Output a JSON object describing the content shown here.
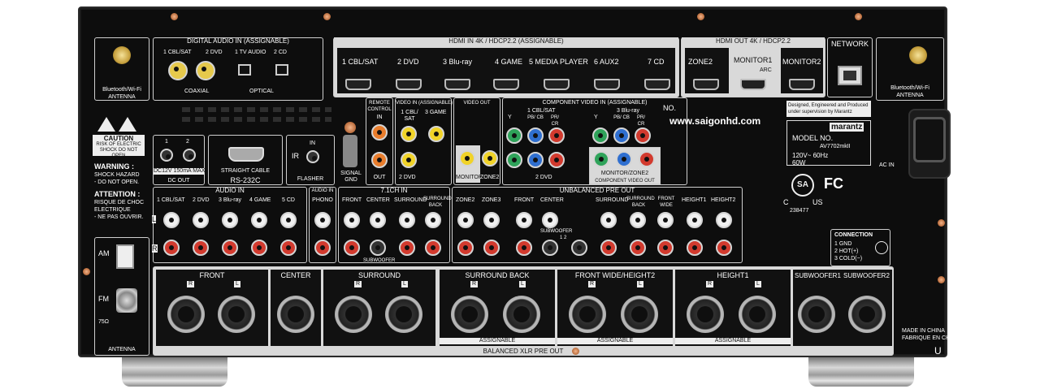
{
  "labels": {
    "bt_antenna_left": "Bluetooth/Wi-Fi",
    "bt_antenna_left_2": "ANTENNA",
    "digital_audio_in": "DIGITAL AUDIO IN",
    "assignable": "(ASSIGNABLE)",
    "digital_ports": [
      "1 CBL/SAT",
      "2 DVD",
      "1 TV AUDIO",
      "2 CD"
    ],
    "coaxial": "COAXIAL",
    "optical": "OPTICAL",
    "hdmi_in": "HDMI IN",
    "hdmi_spec": "4K / HDCP2.2",
    "hdmi_in_ports": [
      "1 CBL/SAT",
      "2 DVD",
      "3 Blu-ray",
      "4 GAME",
      "5 MEDIA PLAYER",
      "6 AUX2",
      "7 CD"
    ],
    "hdmi_out": "HDMI OUT",
    "hdmi_out_ports": [
      "ZONE2",
      "MONITOR1",
      "MONITOR2"
    ],
    "arc": "ARC",
    "network": "NETWORK",
    "bt_antenna_right": "Bluetooth/Wi-Fi",
    "bt_antenna_right_2": "ANTENNA",
    "remote_control": "REMOTE CONTROL",
    "remote_in": "IN",
    "remote_out": "OUT",
    "video_in": "VIDEO IN",
    "video_in_assignable": "(ASSIGNABLE)",
    "video_out": "VIDEO OUT",
    "video_ports": [
      "1 CBL/ SAT",
      "3 GAME",
      "2 DVD",
      "MONITOR",
      "ZONE2"
    ],
    "component_video_in": "COMPONENT VIDEO IN",
    "component_assignable": "(ASSIGNABLE)",
    "component_ports": [
      "1 CBL/SAT",
      "3 Blu-ray",
      "2 DVD",
      "MONITOR/ZONE2"
    ],
    "component_pins": [
      "Y",
      "PB/ CB",
      "PR/ CR"
    ],
    "component_video_out": "COMPONENT VIDEO OUT",
    "no_label": "NO.",
    "website": "www.saigonhd.com",
    "designed_1": "Designed, Engineered and Produced",
    "designed_2": "under supervision by Marantz",
    "brand": "marantz",
    "model_no": "MODEL NO.",
    "model_name": "AV7702mkII",
    "power_spec": "120V~  60Hz",
    "power_watts": "60W",
    "ac_in": "AC IN",
    "ul_c": "C",
    "ul_us": "US",
    "ul_number": "238477",
    "fc": "FC",
    "csa": "SA",
    "caution": "CAUTION",
    "caution_sub": "RISK OF ELECTRIC SHOCK DO NOT OPEN",
    "warning": "WARNING :",
    "warning_1": "SHOCK HAZARD",
    "warning_2": "- DO NOT OPEN.",
    "attention": "ATTENTION :",
    "attention_1": "RISQUE DE CHOC",
    "attention_2": "ELECTRIQUE",
    "attention_3": "- NE PAS OUVRIR.",
    "dc_ports": [
      "1",
      "2"
    ],
    "dc_spec": "DC12V 150mA MAX.",
    "dc_out": "DC OUT",
    "straight_cable": "STRAIGHT CABLE",
    "rs232c": "RS-232C",
    "ir": "IR",
    "ir_in": "IN",
    "flasher": "FLASHER",
    "signal_gnd": "SIGNAL GND",
    "audio_in": "AUDIO IN",
    "audio_in_ports": [
      "1 CBL/SAT",
      "2 DVD",
      "3 Blu-ray",
      "4 GAME",
      "5 CD"
    ],
    "audio_in_2": "AUDIO IN",
    "phono": "PHONO",
    "ch71_in": "7.1CH IN",
    "ch71_ports": [
      "FRONT",
      "CENTER",
      "SURROUND",
      "SURROUND BACK"
    ],
    "subwoofer": "SUBWOOFER",
    "unbalanced_pre_out": "UNBALANCED PRE OUT",
    "pre_out_ports": [
      "ZONE2",
      "ZONE3",
      "FRONT",
      "CENTER",
      "SURROUND",
      "SURROUND BACK",
      "FRONT WIDE",
      "HEIGHT1",
      "HEIGHT2"
    ],
    "sub_12": "1    2",
    "lr": [
      "L",
      "R"
    ],
    "connection": "CONNECTION",
    "connection_pins": [
      "1 GND",
      "2 HOT(+)",
      "3 COLD(−)"
    ],
    "am": "AM",
    "fm": "FM",
    "ohm": "75Ω",
    "antenna": "ANTENNA",
    "xlr_groups": [
      "FRONT",
      "CENTER",
      "SURROUND",
      "SURROUND BACK",
      "FRONT WIDE/HEIGHT2",
      "HEIGHT1",
      "SUBWOOFER1",
      "SUBWOOFER2"
    ],
    "assignable_caps": "ASSIGNABLE",
    "balanced_xlr": "BALANCED XLR PRE OUT",
    "made_in": "MADE IN CHINA",
    "fabrique": "FABRIQUE EN CHINE",
    "u_mark": "U"
  },
  "colors": {
    "chassis": "#0d0d0d",
    "panel": "#d9d9d9",
    "rca_red": "#d23a2e",
    "rca_white": "#f0f0f0",
    "gold": "#e6c94c"
  }
}
